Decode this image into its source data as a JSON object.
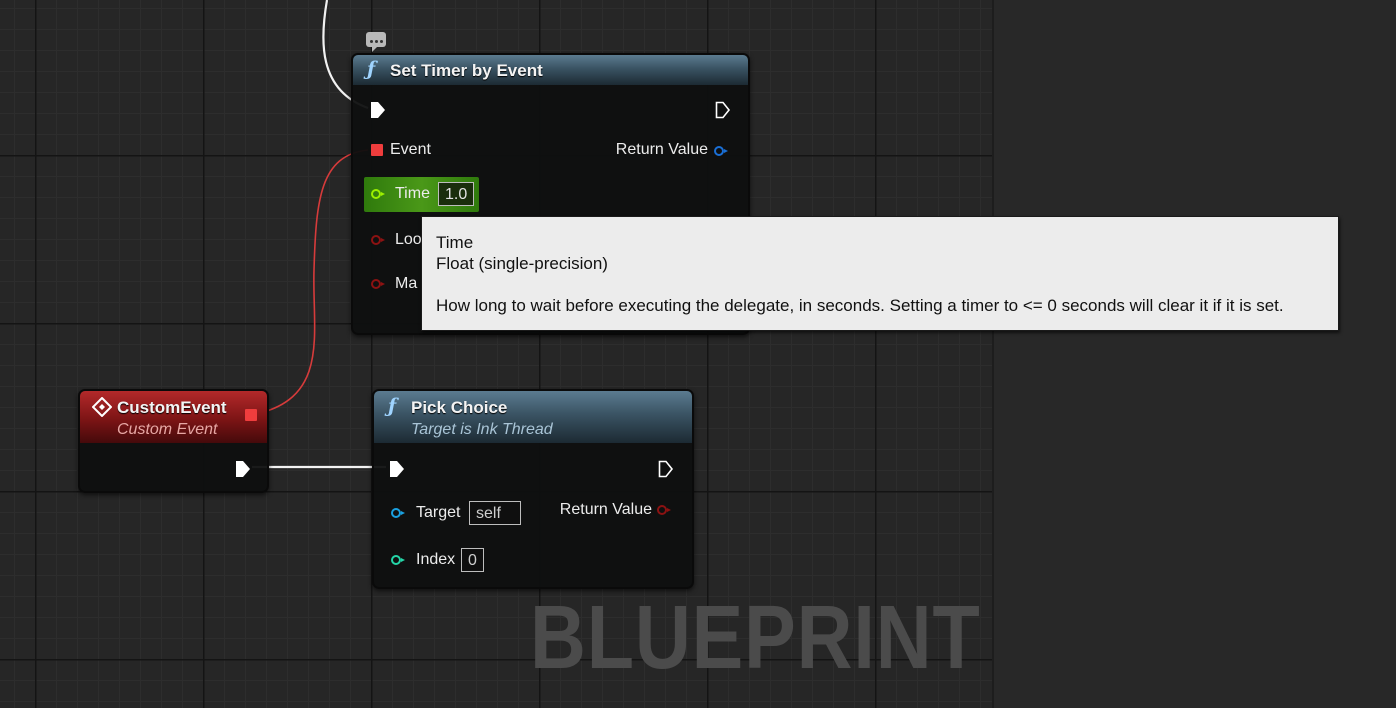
{
  "graph": {
    "watermark": "BLUEPRINT"
  },
  "nodes": {
    "set_timer": {
      "title": "Set Timer by Event",
      "icon": "function-icon",
      "pins": {
        "event": "Event",
        "return_value": "Return Value",
        "time": "Time",
        "time_value": "1.0",
        "looping_partial": "Loo",
        "max_partial": "Ma"
      }
    },
    "custom_event": {
      "title": "CustomEvent",
      "subtitle": "Custom Event",
      "icon": "event-diamond-icon"
    },
    "pick_choice": {
      "title": "Pick Choice",
      "subtitle": "Target is Ink Thread",
      "icon": "function-icon",
      "pins": {
        "target": "Target",
        "target_value": "self",
        "return_value": "Return Value",
        "index": "Index",
        "index_value": "0"
      }
    }
  },
  "tooltip": {
    "name": "Time",
    "type": "Float (single-precision)",
    "description": "How long to wait before executing the delegate, in seconds. Setting a timer to <= 0 seconds will clear it if it is set."
  },
  "colors": {
    "exec": "#ffffff",
    "delegate": "#ef3d3d",
    "float": "#9cf000",
    "object": "#1aa0e0",
    "integer": "#24d6a8",
    "bool": "#8c1212",
    "selected_row": "#3b8a10"
  }
}
